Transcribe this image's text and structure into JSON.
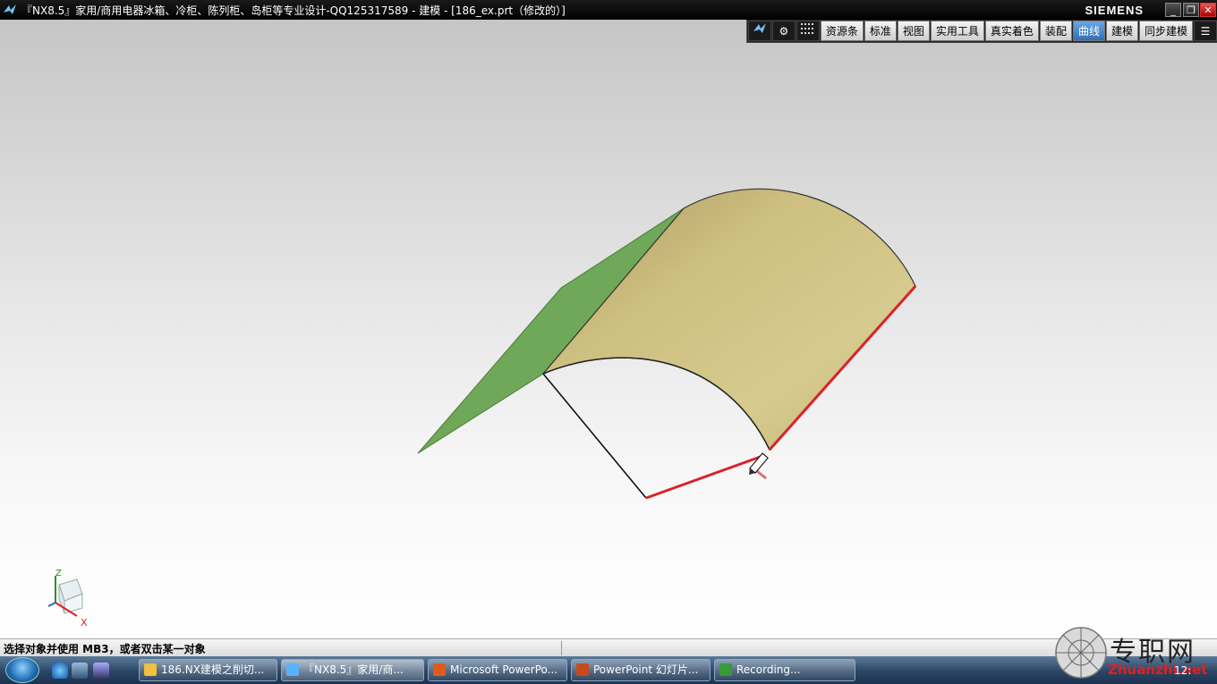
{
  "window": {
    "title": "『NX8.5』家用/商用电器冰箱、冷柜、陈列柜、岛柜等专业设计-QQ125317589 - 建模 - [186_ex.prt（修改的）]",
    "brand": "SIEMENS",
    "min_label": "_",
    "restore_label": "❐",
    "close_label": "✕"
  },
  "toolbar": {
    "items": [
      {
        "label": "资源条"
      },
      {
        "label": "标准"
      },
      {
        "label": "视图"
      },
      {
        "label": "实用工具"
      },
      {
        "label": "真实着色"
      },
      {
        "label": "装配"
      },
      {
        "label": "曲线"
      },
      {
        "label": "建模"
      },
      {
        "label": "同步建模"
      }
    ],
    "active": "曲线",
    "icons": [
      "nx-logo-icon",
      "gear-icon",
      "grid-icon",
      "menu-icon"
    ]
  },
  "triad": {
    "z_label": "Z",
    "x_label": "X"
  },
  "status": {
    "text": "选择对象并使用 MB3，或者双击某一对象"
  },
  "taskbar": {
    "tasks": [
      {
        "label": "186.NX建模之削切..."
      },
      {
        "label": "『NX8.5』家用/商..."
      },
      {
        "label": "Microsoft PowerPo..."
      },
      {
        "label": "PowerPoint 幻灯片..."
      },
      {
        "label": "Recording..."
      }
    ],
    "clock": "12:"
  },
  "watermark": {
    "text1": "专职网",
    "text2": "Zhuanzhi.net"
  },
  "colors": {
    "surface": "#cdbf7f",
    "green_face": "#6fa858",
    "highlight_edge": "#d8232a",
    "viewport_top": "#c6c6c6"
  }
}
